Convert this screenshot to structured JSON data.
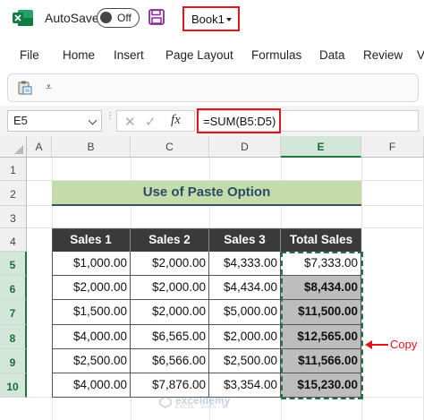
{
  "titlebar": {
    "autosave_label": "AutoSave",
    "autosave_state": "Off",
    "workbook_name": "Book1",
    "icons": [
      "excel-logo-icon",
      "save-icon",
      "chevron-down-icon"
    ]
  },
  "ribbon": {
    "tabs": [
      "File",
      "Home",
      "Insert",
      "Page Layout",
      "Formulas",
      "Data",
      "Review",
      "V"
    ]
  },
  "qat": {
    "more_glyph": "⩡"
  },
  "formula_bar": {
    "name_box": "E5",
    "fx_label": "fx",
    "formula": "=SUM(B5:D5)"
  },
  "sheet": {
    "columns": [
      "A",
      "B",
      "C",
      "D",
      "E",
      "F"
    ],
    "rows": [
      "1",
      "2",
      "3",
      "4",
      "5",
      "6",
      "7",
      "8",
      "9",
      "10"
    ],
    "selected_column": "E",
    "selected_rows": [
      "5",
      "6",
      "7",
      "8",
      "9",
      "10"
    ],
    "title": "Use of Paste Option",
    "headers": [
      "Sales 1",
      "Sales 2",
      "Sales 3",
      "Total Sales"
    ],
    "data": [
      [
        "$1,000.00",
        "$2,000.00",
        "$4,333.00",
        "$7,333.00"
      ],
      [
        "$2,000.00",
        "$2,000.00",
        "$4,434.00",
        "$8,434.00"
      ],
      [
        "$1,500.00",
        "$2,000.00",
        "$5,000.00",
        "$11,500.00"
      ],
      [
        "$4,000.00",
        "$6,565.00",
        "$2,000.00",
        "$12,565.00"
      ],
      [
        "$2,500.00",
        "$6,566.00",
        "$2,500.00",
        "$11,566.00"
      ],
      [
        "$4,000.00",
        "$7,876.00",
        "$3,354.00",
        "$15,230.00"
      ]
    ]
  },
  "annotation": {
    "copy_label": "Copy",
    "highlight_color": "#e0161f"
  },
  "watermark": {
    "name": "exceldemy",
    "tagline": "EXCEL · DATA · BI"
  }
}
